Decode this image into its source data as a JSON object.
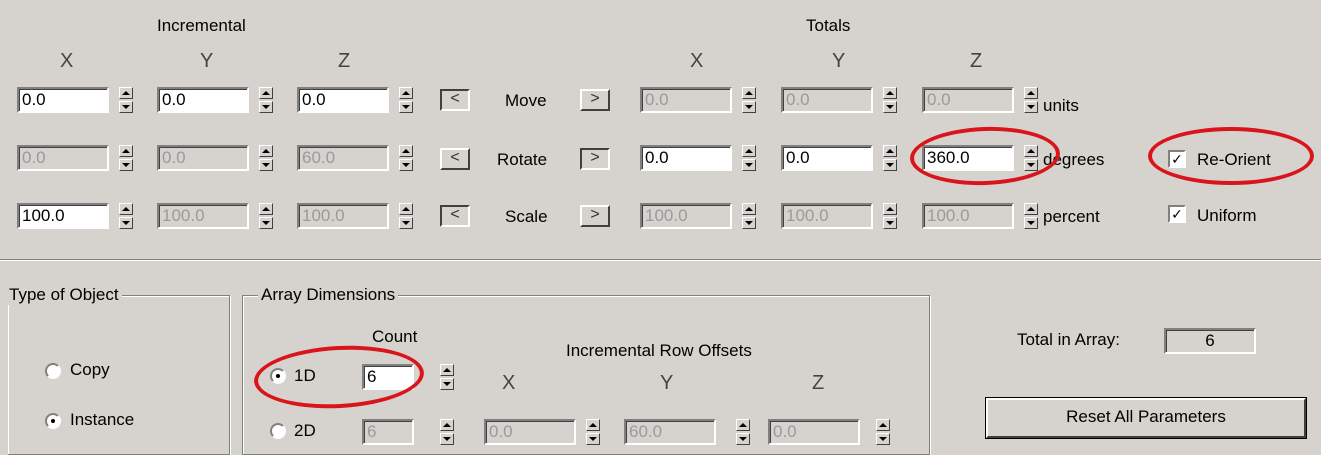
{
  "headers": {
    "incremental": "Incremental",
    "totals": "Totals"
  },
  "axes": {
    "x": "X",
    "y": "Y",
    "z": "Z"
  },
  "rows": {
    "move": {
      "label": "Move",
      "inc": [
        "0.0",
        "0.0",
        "0.0"
      ],
      "tot": [
        "0.0",
        "0.0",
        "0.0"
      ],
      "unit": "units",
      "left_arrow": "<",
      "right_arrow": ">"
    },
    "rotate": {
      "label": "Rotate",
      "inc": [
        "0.0",
        "0.0",
        "60.0"
      ],
      "tot": [
        "0.0",
        "0.0",
        "360.0"
      ],
      "unit": "degrees",
      "left_arrow": "<",
      "right_arrow": ">",
      "option": {
        "label": "Re-Orient",
        "checked": true
      }
    },
    "scale": {
      "label": "Scale",
      "inc": [
        "100.0",
        "100.0",
        "100.0"
      ],
      "tot": [
        "100.0",
        "100.0",
        "100.0"
      ],
      "unit": "percent",
      "left_arrow": "<",
      "right_arrow": ">",
      "option": {
        "label": "Uniform",
        "checked": true
      }
    }
  },
  "type_of_object": {
    "title": "Type of Object",
    "options": [
      {
        "label": "Copy",
        "selected": false
      },
      {
        "label": "Instance",
        "selected": true
      }
    ]
  },
  "array_dimensions": {
    "title": "Array Dimensions",
    "count_header": "Count",
    "offsets_header": "Incremental Row Offsets",
    "dims": [
      {
        "label": "1D",
        "count": "6",
        "selected": true
      },
      {
        "label": "2D",
        "count": "6",
        "selected": false,
        "offsets": [
          "0.0",
          "60.0",
          "0.0"
        ]
      }
    ]
  },
  "total_in_array": {
    "label": "Total in Array:",
    "value": "6"
  },
  "reset_button": "Reset All Parameters",
  "colors": {
    "panel": "#d6d3ce",
    "annotation": "#d9151b"
  }
}
